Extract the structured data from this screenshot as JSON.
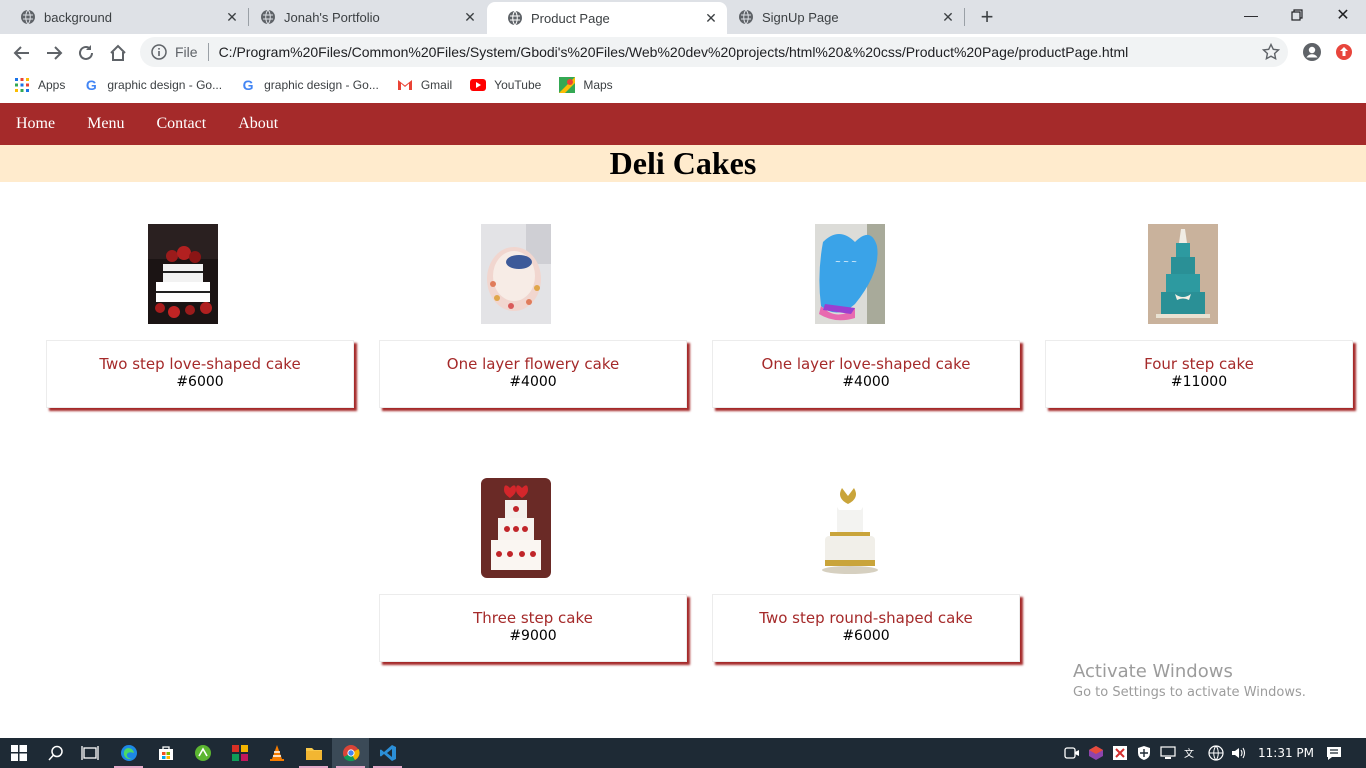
{
  "browser": {
    "tabs": [
      {
        "title": "background",
        "active": false
      },
      {
        "title": "Jonah's Portfolio",
        "active": false
      },
      {
        "title": "Product Page",
        "active": true
      },
      {
        "title": "SignUp Page",
        "active": false
      }
    ],
    "address": {
      "scheme_label": "File",
      "url": "C:/Program%20Files/Common%20Files/System/Gbodi's%20Files/Web%20dev%20projects/html%20&%20css/Product%20Page/productPage.html"
    },
    "bookmarks": [
      {
        "label": "Apps",
        "icon": "apps-grid-icon"
      },
      {
        "label": "graphic design - Go...",
        "icon": "google-icon"
      },
      {
        "label": "graphic design - Go...",
        "icon": "google-icon"
      },
      {
        "label": "Gmail",
        "icon": "gmail-icon"
      },
      {
        "label": "YouTube",
        "icon": "youtube-icon"
      },
      {
        "label": "Maps",
        "icon": "maps-icon"
      }
    ]
  },
  "site": {
    "nav": [
      "Home",
      "Menu",
      "Contact",
      "About"
    ],
    "heading": "Deli Cakes",
    "products": [
      {
        "name": "Two step love-shaped cake",
        "price": "#6000",
        "image": "cake-red-roses-photo"
      },
      {
        "name": "One layer flowery cake",
        "price": "#4000",
        "image": "cake-flowery-photo"
      },
      {
        "name": "One layer love-shaped cake",
        "price": "#4000",
        "image": "cake-blue-heart-photo"
      },
      {
        "name": "Four step cake",
        "price": "#11000",
        "image": "cake-teal-tiered-photo"
      },
      {
        "name": "Three step cake",
        "price": "#9000",
        "image": "cake-hearts-tiered-photo"
      },
      {
        "name": "Two step round-shaped cake",
        "price": "#6000",
        "image": "cake-gold-bow-photo"
      }
    ],
    "colors": {
      "nav_bg": "#a52a2a",
      "banner_bg": "#ffebcd",
      "product_name": "#a52a2a"
    }
  },
  "watermark": {
    "line1": "Activate Windows",
    "line2": "Go to Settings to activate Windows."
  },
  "taskbar": {
    "time": "11:31 PM"
  }
}
